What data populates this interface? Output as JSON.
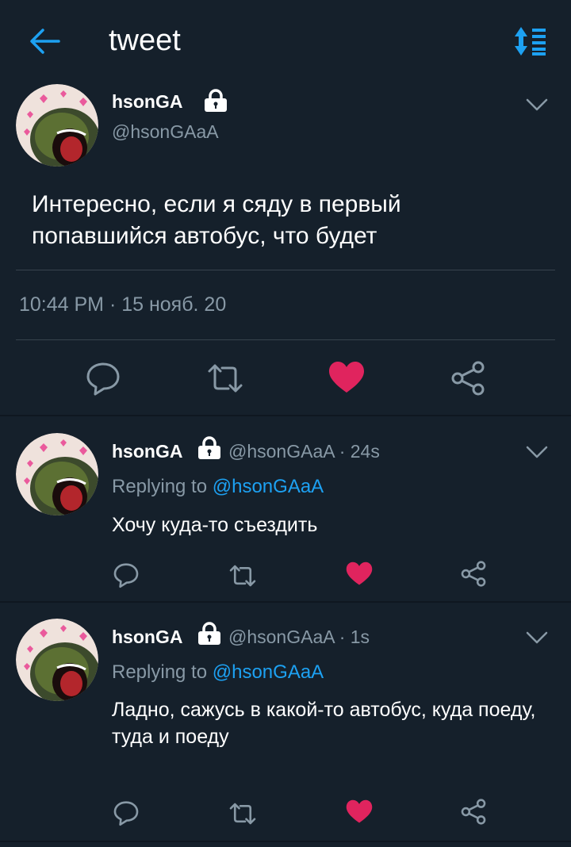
{
  "header": {
    "title": "tweet"
  },
  "main_tweet": {
    "display_name": "hsonGA",
    "handle": "@hsonGAaA",
    "text": "Интересно, если я сяду в первый попавшийся автобус, что будет",
    "timestamp": "10:44 PM · 15 нояб. 20",
    "liked": true
  },
  "replies": [
    {
      "display_name": "hsonGA",
      "handle_time": "@hsonGAaA · 24s",
      "replying_prefix": "Replying to ",
      "replying_to": "@hsonGAaA",
      "text": "Хочу куда-то съездить"
    },
    {
      "display_name": "hsonGA",
      "handle_time": "@hsonGAaA · 1s",
      "replying_prefix": "Replying to ",
      "replying_to": "@hsonGAaA",
      "text": "Ладно, сажусь в какой-то автобус, куда поеду, туда и поеду"
    }
  ],
  "colors": {
    "background": "#15202b",
    "accent": "#1da1f2",
    "like": "#e0245e",
    "secondary_text": "#8899a6"
  }
}
